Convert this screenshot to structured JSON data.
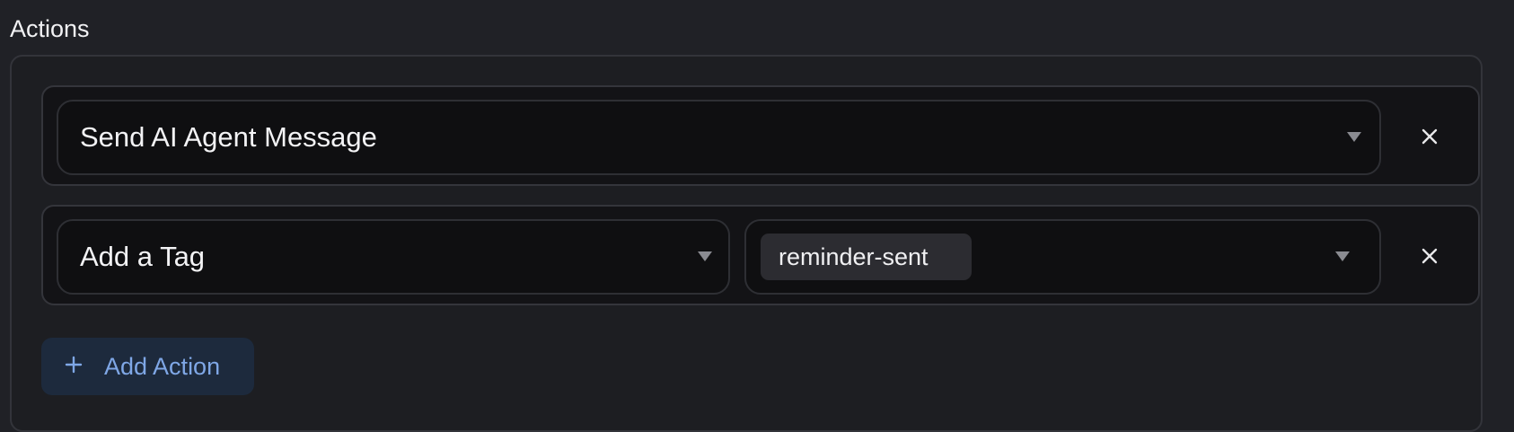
{
  "section": {
    "title": "Actions"
  },
  "actions": [
    {
      "type_label": "Send AI Agent Message"
    },
    {
      "type_label": "Add a Tag",
      "tag_value": "reminder-sent"
    }
  ],
  "icons": {
    "dropdown": "caret-down-icon",
    "remove": "close-icon",
    "add": "plus-icon"
  },
  "add_action": {
    "label": "Add Action"
  },
  "colors": {
    "background": "#202126",
    "card": "#131316",
    "select": "#0f0f11",
    "chip": "#2c2c31",
    "accent": "#7fa7e6",
    "add_button_bg": "#1d2a3d"
  }
}
